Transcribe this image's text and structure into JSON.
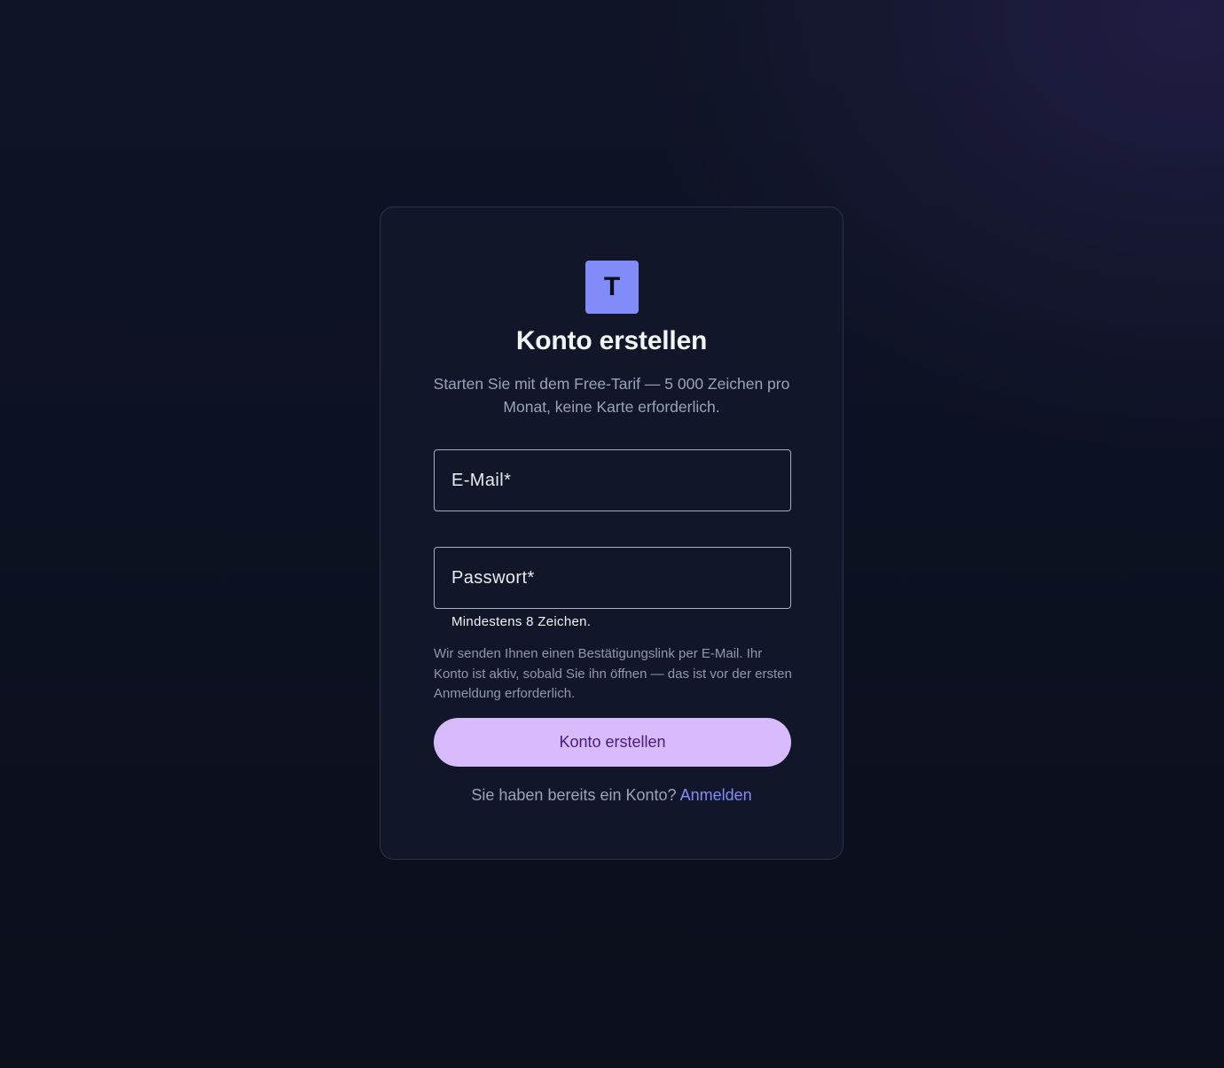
{
  "brand": {
    "logo_letter": "T",
    "logo_color": "#818cf8"
  },
  "signup": {
    "title": "Konto erstellen",
    "subtitle": "Starten Sie mit dem Free-Tarif — 5 000 Zeichen pro Monat, keine Karte erforderlich.",
    "email": {
      "placeholder": "E-Mail*",
      "value": ""
    },
    "password": {
      "placeholder": "Passwort*",
      "value": "",
      "helper": "Mindestens 8 Zeichen."
    },
    "note": "Wir senden Ihnen einen Bestätigungslink per E-Mail. Ihr Konto ist aktiv, sobald Sie ihn öffnen — das ist vor der ersten Anmeldung erforderlich.",
    "submit_label": "Konto erstellen",
    "footer_text": "Sie haben bereits ein Konto?",
    "login_link": "Anmelden"
  },
  "colors": {
    "button_bg": "#d7bbfb",
    "button_text": "#4a1a7c",
    "link": "#818cf8",
    "card_bg": "#111729"
  }
}
